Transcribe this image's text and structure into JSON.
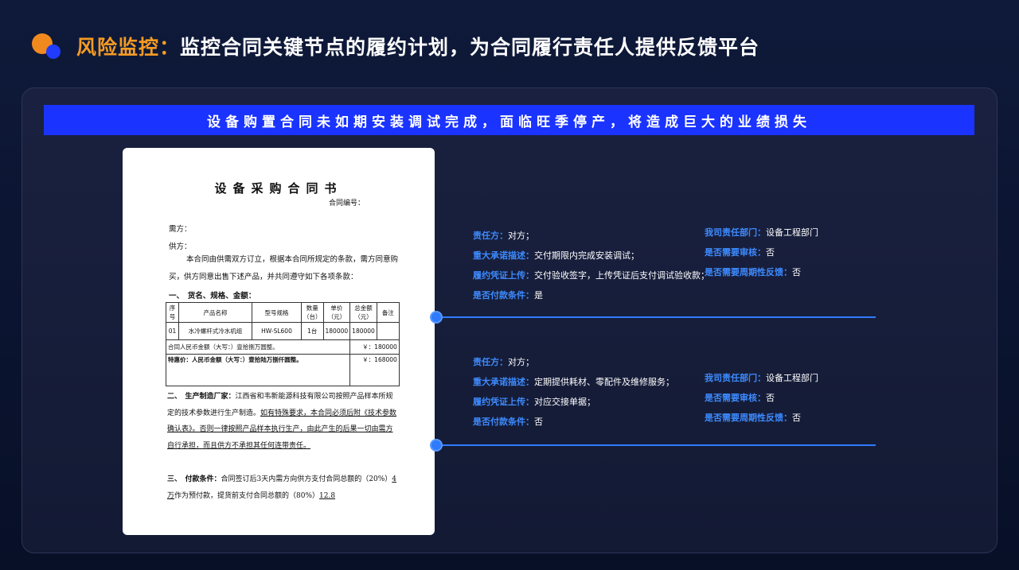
{
  "header": {
    "accent": "风险监控：",
    "title": "监控合同关键节点的履约计划，为合同履行责任人提供反馈平台"
  },
  "banner": "设备购置合同未如期安装调试完成，面临旺季停产，将造成巨大的业绩损失",
  "document": {
    "title": "设备采购合同书",
    "contract_no": "合同编号：",
    "buyer": "需方：",
    "supplier": "供方：",
    "intro": "本合同由供需双方订立，根据本合同所规定的条款，需方同意购买，供方同意出售下述产品，并共同遵守如下各项条款：",
    "section1": "一、　货名、规格、金额：",
    "table": {
      "headers": [
        "序号",
        "产品名称",
        "型号规格",
        "数量（台）",
        "单价（元）",
        "总金额（元）",
        "备注"
      ],
      "row": [
        "01",
        "水冷螺杆式冷水机组",
        "HW-SL600",
        "1台",
        "180000",
        "180000",
        ""
      ],
      "total_label": "合同人民币金额（大写：）壹拾捌万圆整。",
      "total_value": "￥：180000",
      "special_label": "特惠价：人民币金额（大写：）壹拾陆万捌仟圆整。",
      "special_value": "￥：168000"
    },
    "section2_head": "二、　生产制造厂家：",
    "section2_text": "江西省和韦新能源科技有限公司按照产品样本所规定的技术参数进行生产制造。",
    "section2_underline": "如有特殊要求，本合同必须后附《技术参数确认表》。否则一律按照产品样本执行生产，由此产生的后果一切由需方自行承担，而且供方不承担其任何连带责任。",
    "section3_head": "三、　付款条件：",
    "section3_text": "合同签订后3天内需方向供方支付合同总额的（20%）",
    "section3_amount": "4万",
    "section3_rest": "作为预付款，提货前支付合同总额的（80%）",
    "section3_amount2": "12.8"
  },
  "nodes": [
    {
      "left": [
        {
          "label": "责任方：",
          "value": "对方；"
        },
        {
          "label": "重大承诺描述：",
          "value": "交付期限内完成安装调试；"
        },
        {
          "label": "履约凭证上传：",
          "value": "交付验收签字，上传凭证后支付调试验收款；"
        },
        {
          "label": "是否付款条件：",
          "value": "是"
        }
      ],
      "right": [
        {
          "label": "我司责任部门：",
          "value": "设备工程部门"
        },
        {
          "label": "是否需要审核：",
          "value": "否"
        },
        {
          "label": "是否需要周期性反馈：",
          "value": "否"
        }
      ]
    },
    {
      "left": [
        {
          "label": "责任方：",
          "value": "对方；"
        },
        {
          "label": "重大承诺描述：",
          "value": "定期提供耗材、零配件及维修服务；"
        },
        {
          "label": "履约凭证上传：",
          "value": "对应交接单据；"
        },
        {
          "label": "是否付款条件：",
          "value": "否"
        }
      ],
      "right": [
        {
          "label": "我司责任部门：",
          "value": "设备工程部门"
        },
        {
          "label": "是否需要审核：",
          "value": "否"
        },
        {
          "label": "是否需要周期性反馈：",
          "value": "否"
        }
      ]
    }
  ],
  "colors": {
    "accent_orange": "#f59b23",
    "brand_blue": "#1a33ff",
    "label_blue": "#3d8bff",
    "timeline": "#2f7bff"
  }
}
